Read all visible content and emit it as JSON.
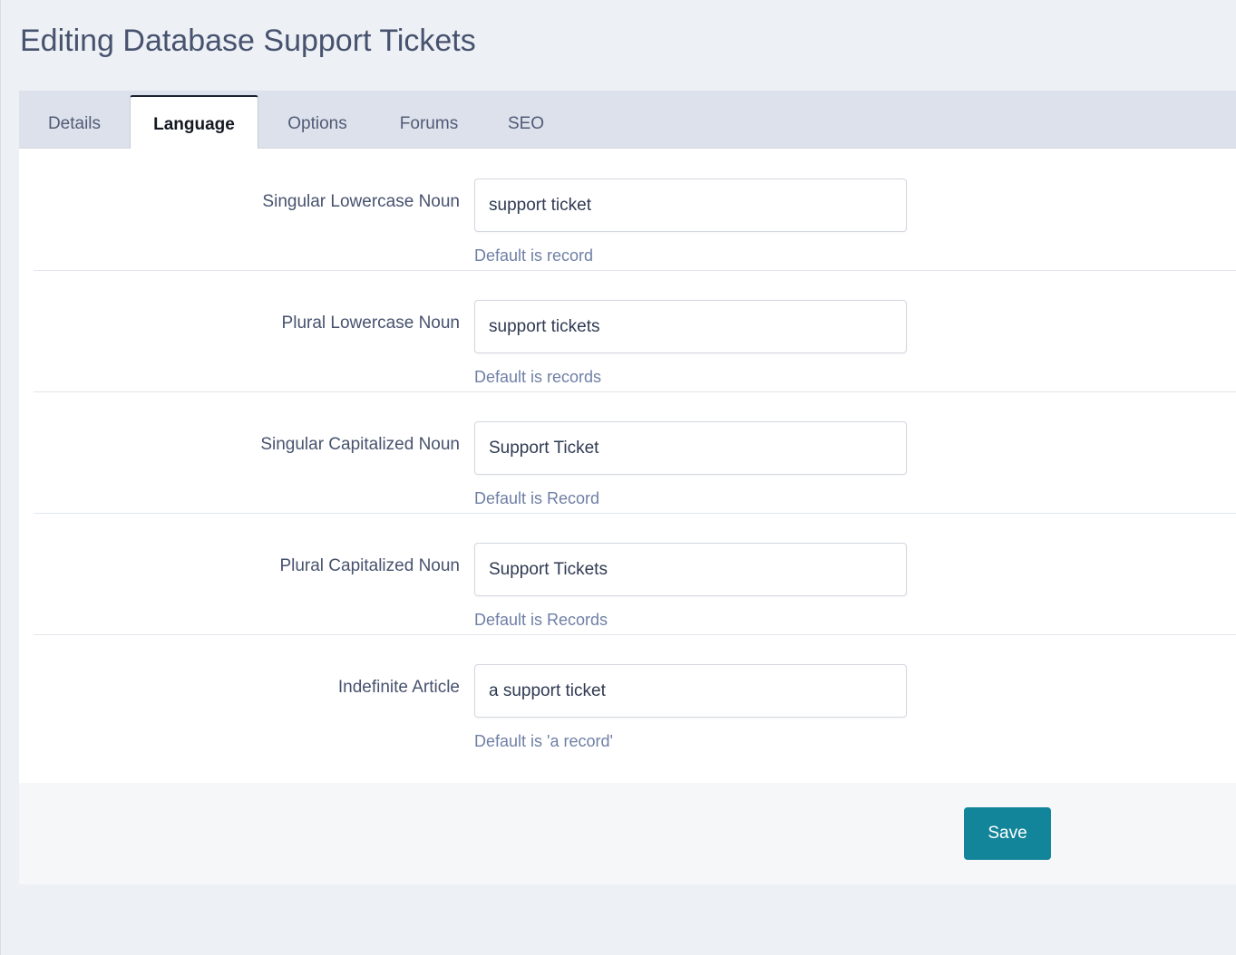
{
  "page": {
    "title": "Editing Database Support Tickets"
  },
  "tabs": [
    {
      "label": "Details",
      "active": false
    },
    {
      "label": "Language",
      "active": true
    },
    {
      "label": "Options",
      "active": false
    },
    {
      "label": "Forums",
      "active": false
    },
    {
      "label": "SEO",
      "active": false
    }
  ],
  "fields": [
    {
      "label": "Singular Lowercase Noun",
      "value": "support ticket",
      "hint": "Default is record"
    },
    {
      "label": "Plural Lowercase Noun",
      "value": "support tickets",
      "hint": "Default is records"
    },
    {
      "label": "Singular Capitalized Noun",
      "value": "Support Ticket",
      "hint": "Default is Record"
    },
    {
      "label": "Plural Capitalized Noun",
      "value": "Support Tickets",
      "hint": "Default is Records"
    },
    {
      "label": "Indefinite Article",
      "value": "a support ticket",
      "hint": "Default is 'a record'"
    }
  ],
  "footer": {
    "save_label": "Save"
  },
  "colors": {
    "accent": "#13859a",
    "page_background": "#edf0f5",
    "tabbar_background": "#dde1eb",
    "hint_text": "#6f7fa5"
  }
}
